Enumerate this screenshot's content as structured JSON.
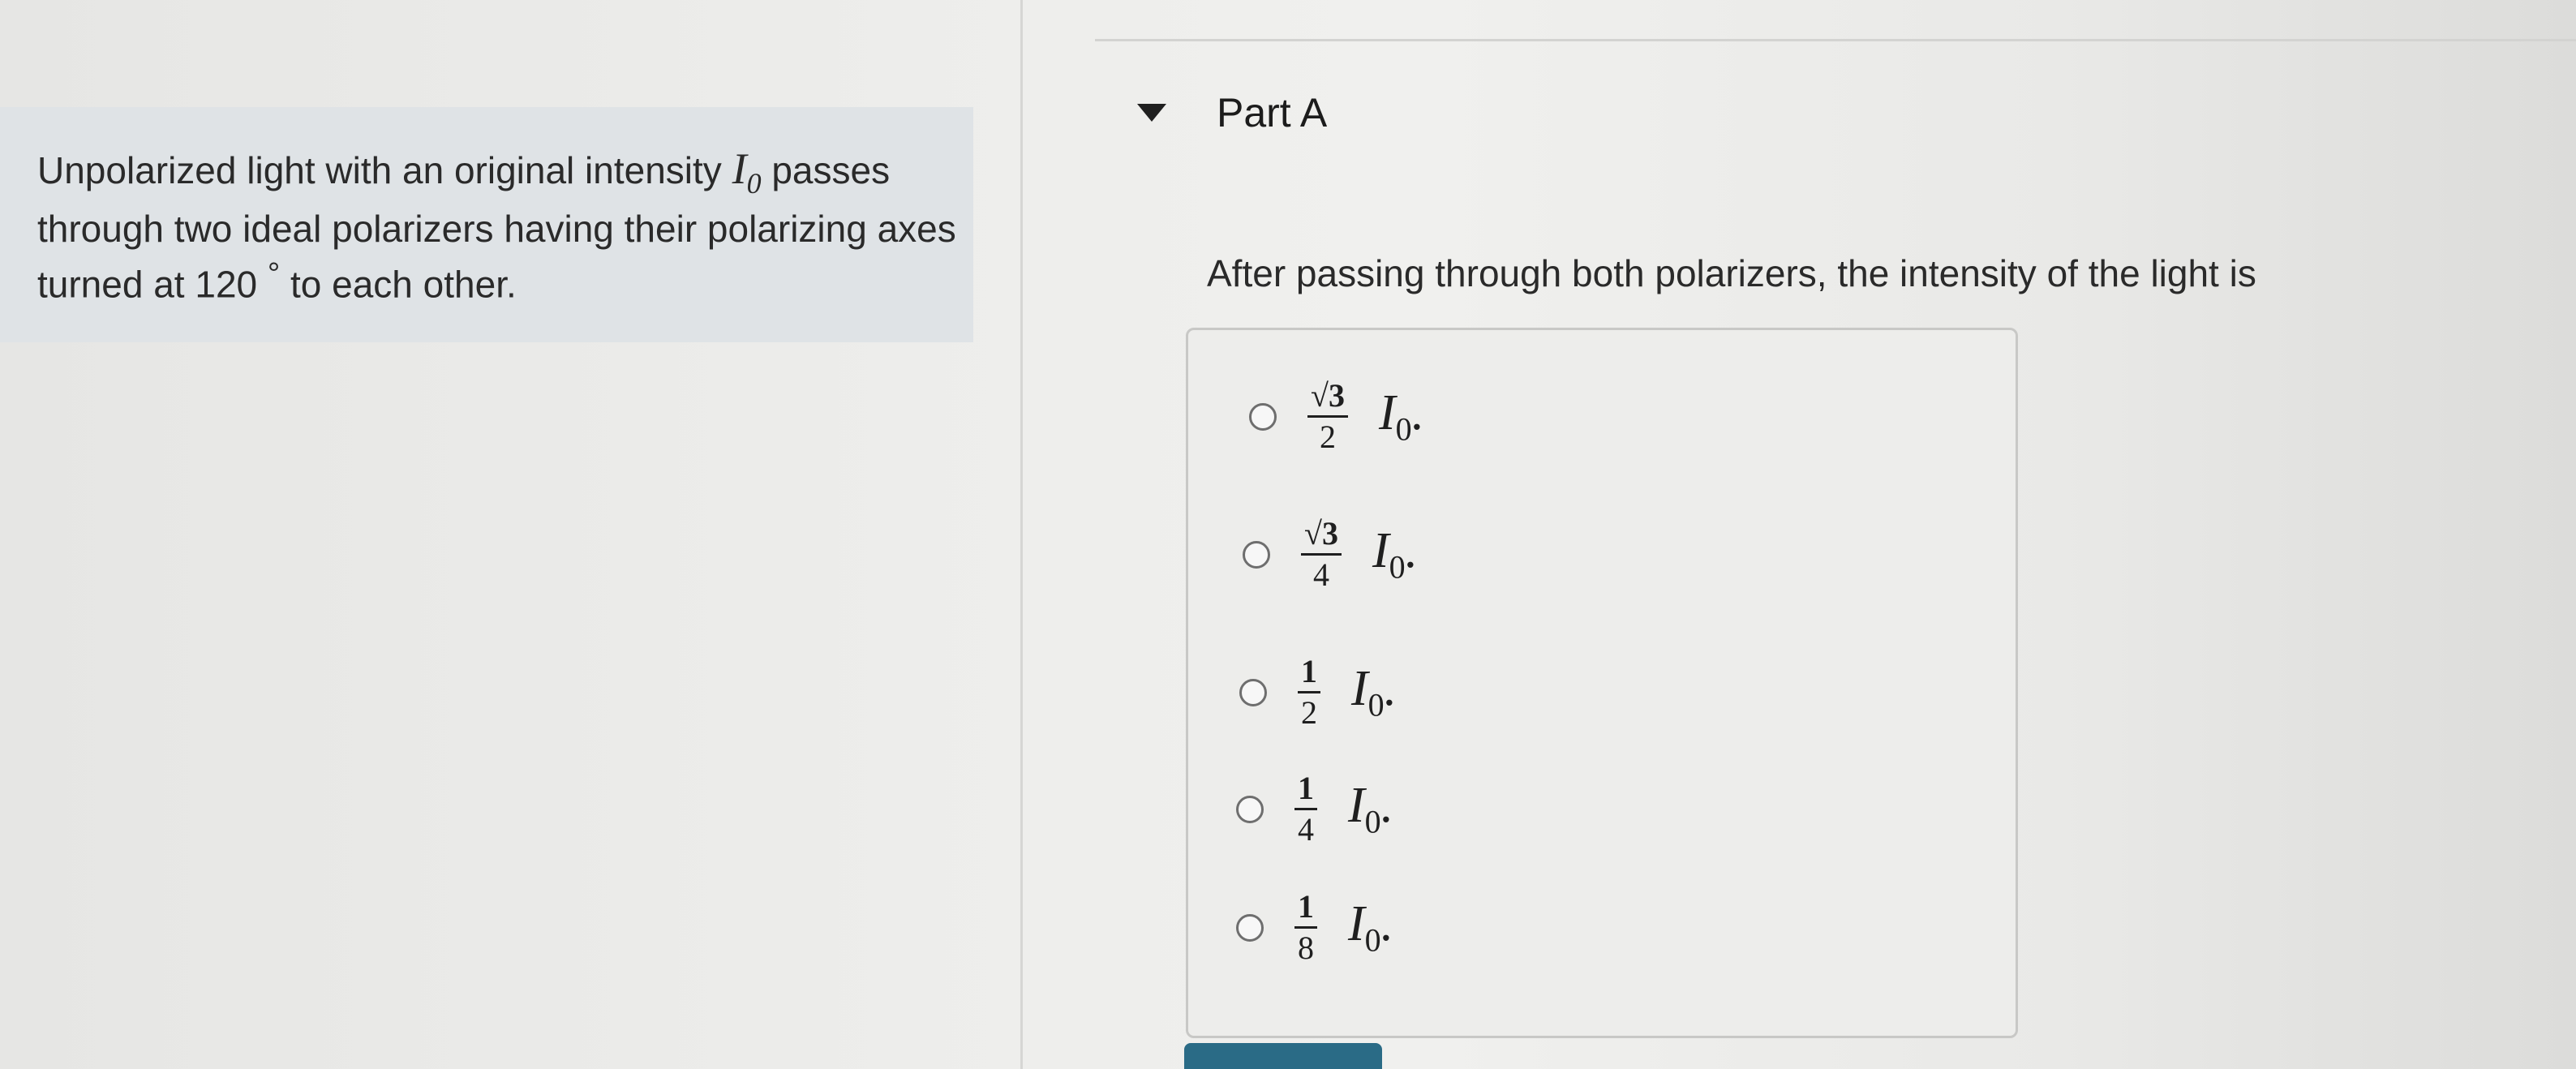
{
  "problem": {
    "text_a": "Unpolarized light with an original intensity",
    "intensity_symbol": "I",
    "intensity_sub": "0",
    "text_b": "passes through two ideal polarizers having their polarizing axes turned at 120",
    "degree": "°",
    "text_c": "to each other."
  },
  "part": {
    "title": "Part A",
    "question": "After passing through both polarizers, the intensity of the light is"
  },
  "choices": [
    {
      "num": "√3",
      "den": "2",
      "symbol": "I",
      "sub": "0",
      "end": "."
    },
    {
      "num": "√3",
      "den": "4",
      "symbol": "I",
      "sub": "0",
      "end": "."
    },
    {
      "num": "1",
      "den": "2",
      "symbol": "I",
      "sub": "0",
      "end": "."
    },
    {
      "num": "1",
      "den": "4",
      "symbol": "I",
      "sub": "0",
      "end": "."
    },
    {
      "num": "1",
      "den": "8",
      "symbol": "I",
      "sub": "0",
      "end": "."
    }
  ]
}
